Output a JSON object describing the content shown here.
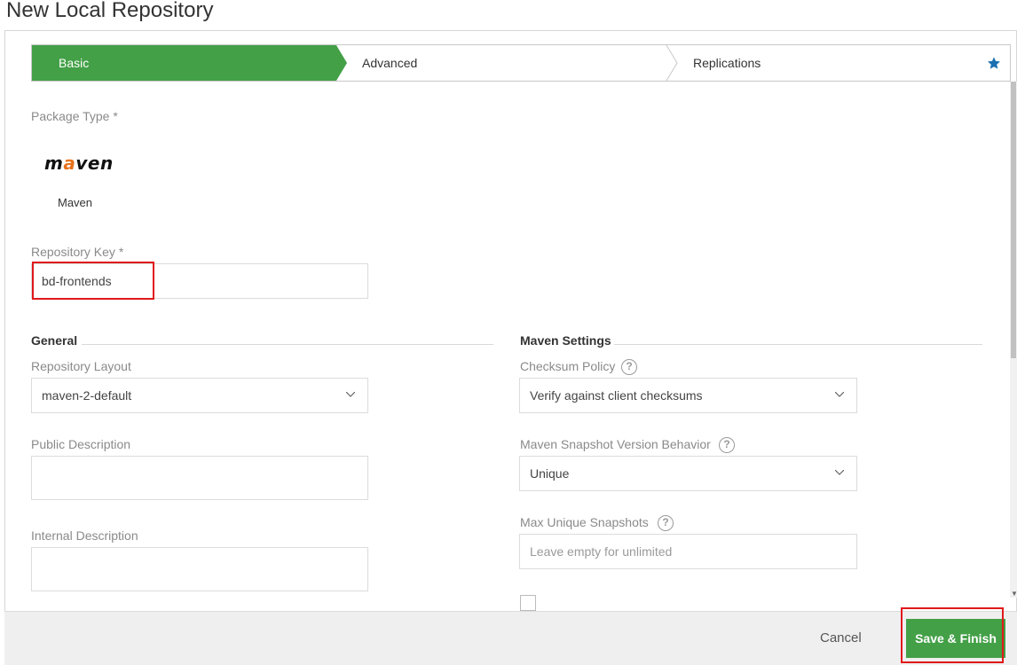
{
  "page": {
    "title": "New Local Repository"
  },
  "wizard": {
    "steps": [
      {
        "label": "Basic"
      },
      {
        "label": "Advanced"
      },
      {
        "label": "Replications"
      }
    ]
  },
  "package": {
    "label": "Package Type *",
    "logo_text_a": "m",
    "logo_text_b": "a",
    "logo_text_c": "ven",
    "name": "Maven"
  },
  "repo_key": {
    "label": "Repository Key *",
    "value": "bd-frontends"
  },
  "general": {
    "title": "General",
    "layout_label": "Repository Layout",
    "layout_value": "maven-2-default",
    "public_desc_label": "Public Description",
    "internal_desc_label": "Internal Description"
  },
  "maven_settings": {
    "title": "Maven Settings",
    "checksum_label": "Checksum Policy",
    "checksum_value": "Verify against client checksums",
    "snapshot_label": "Maven Snapshot Version Behavior",
    "snapshot_value": "Unique",
    "max_snapshots_label": "Max Unique Snapshots",
    "max_snapshots_placeholder": "Leave empty for unlimited",
    "help_glyph": "?"
  },
  "footer": {
    "cancel_label": "Cancel",
    "save_label": "Save & Finish"
  },
  "colors": {
    "accent": "#43a047",
    "highlight": "#e0191b",
    "star": "#1a6fb0"
  }
}
